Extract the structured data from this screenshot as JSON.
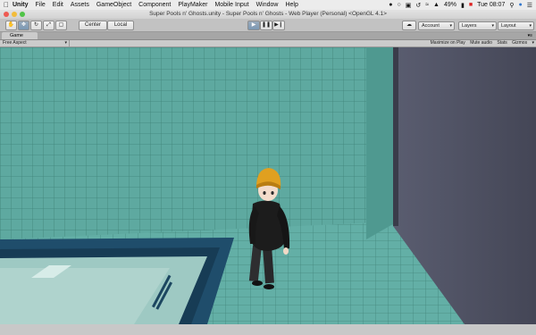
{
  "menubar": {
    "items": [
      "Unity",
      "File",
      "Edit",
      "Assets",
      "GameObject",
      "Component",
      "PlayMaker",
      "Mobile Input",
      "Window",
      "Help"
    ],
    "status": {
      "battery": "49%",
      "time": "Tue 08:07"
    }
  },
  "window": {
    "title": "Super Pools n' Ghosts.unity - Super Pools n' Ghosts - Web Player (Personal) <OpenGL 4.1>"
  },
  "toolbar": {
    "pivot_label": "Center",
    "space_label": "Local",
    "account_label": "Account",
    "layers_label": "Layers",
    "layout_label": "Layout"
  },
  "game_view": {
    "tab_label": "Game",
    "aspect_label": "Free Aspect",
    "options": [
      "Maximize on Play",
      "Mute audio",
      "Stats",
      "Gizmos"
    ]
  },
  "colors": {
    "floor": "#5ea9a0",
    "grid": "#3f8278",
    "wall_dark": "#4a4d5e",
    "pool_border": "#1f4d6b",
    "hair": "#e0a020",
    "jacket": "#1c1c1c"
  }
}
